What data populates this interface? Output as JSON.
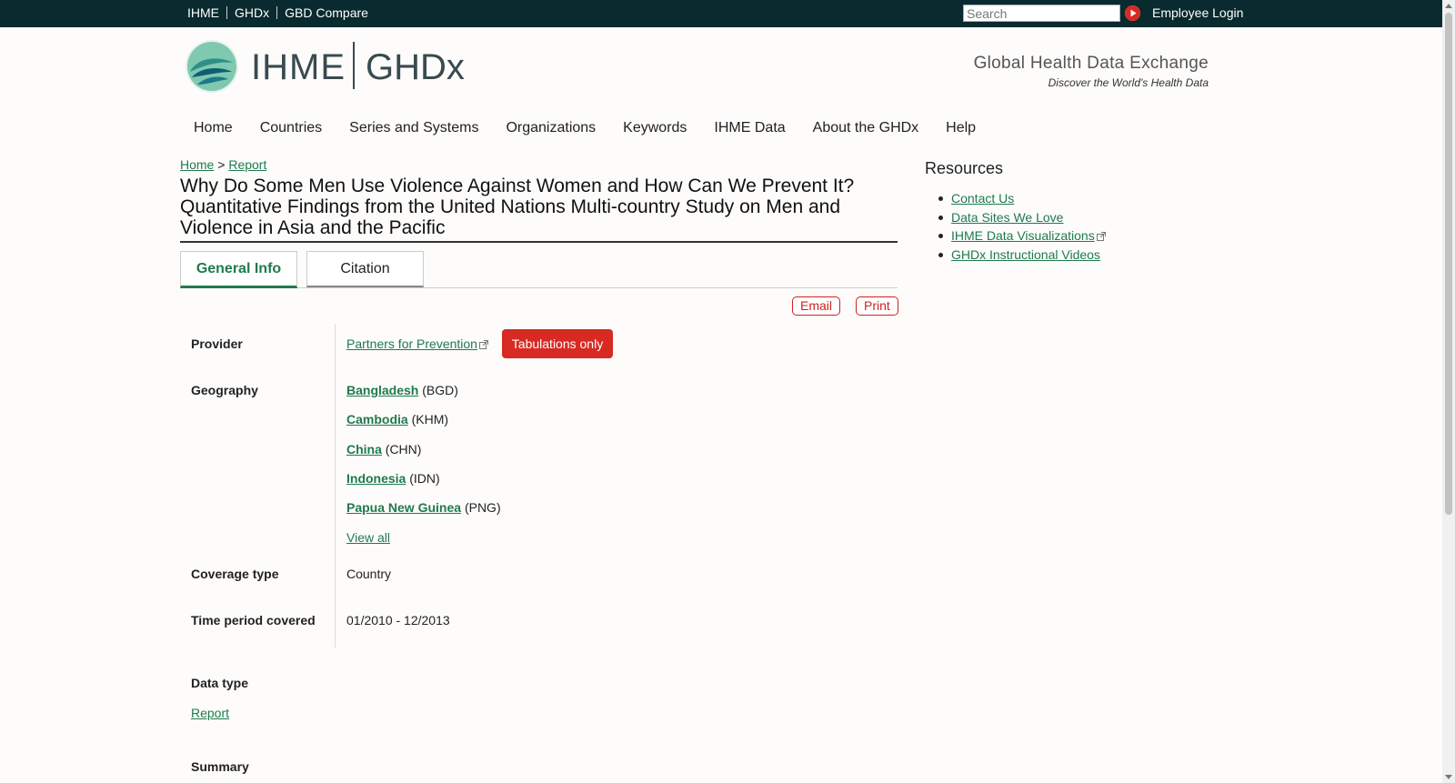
{
  "topbar": {
    "links": [
      "IHME",
      "GHDx",
      "GBD Compare"
    ],
    "search_placeholder": "Search",
    "employee_login": "Employee Login"
  },
  "header": {
    "logo_ihme": "IHME",
    "logo_ghdx": "GHDx",
    "tagline_title": "Global Health Data Exchange",
    "tagline_sub": "Discover the World's Health Data"
  },
  "nav": [
    "Home",
    "Countries",
    "Series and Systems",
    "Organizations",
    "Keywords",
    "IHME Data",
    "About the GHDx",
    "Help"
  ],
  "breadcrumb": {
    "home": "Home",
    "separator": ">",
    "current": "Report"
  },
  "page_title": "Why Do Some Men Use Violence Against Women and How Can We Prevent It? Quantitative Findings from the United Nations Multi-country Study on Men and Violence in Asia and the Pacific",
  "tabs": {
    "general": "General Info",
    "citation": "Citation"
  },
  "actions": {
    "email": "Email",
    "print": "Print"
  },
  "fields": {
    "provider_label": "Provider",
    "provider_value": "Partners for Prevention",
    "provider_badge": "Tabulations only",
    "geography_label": "Geography",
    "geography": [
      {
        "name": "Bangladesh",
        "code": "(BGD)"
      },
      {
        "name": "Cambodia",
        "code": "(KHM)"
      },
      {
        "name": "China",
        "code": "(CHN)"
      },
      {
        "name": "Indonesia",
        "code": "(IDN)"
      },
      {
        "name": "Papua New Guinea",
        "code": "(PNG)"
      }
    ],
    "view_all": "View all",
    "coverage_label": "Coverage type",
    "coverage_value": "Country",
    "time_label": "Time period covered",
    "time_value": "01/2010 - 12/2013",
    "datatype_label": "Data type",
    "datatype_value": "Report",
    "summary_label": "Summary"
  },
  "sidebar": {
    "title": "Resources",
    "items": [
      "Contact Us",
      "Data Sites We Love",
      "IHME Data Visualizations",
      "GHDx Instructional Videos"
    ]
  },
  "colors": {
    "topbar": "#092a2e",
    "link": "#1f7a4d",
    "badge": "#d72a22"
  }
}
